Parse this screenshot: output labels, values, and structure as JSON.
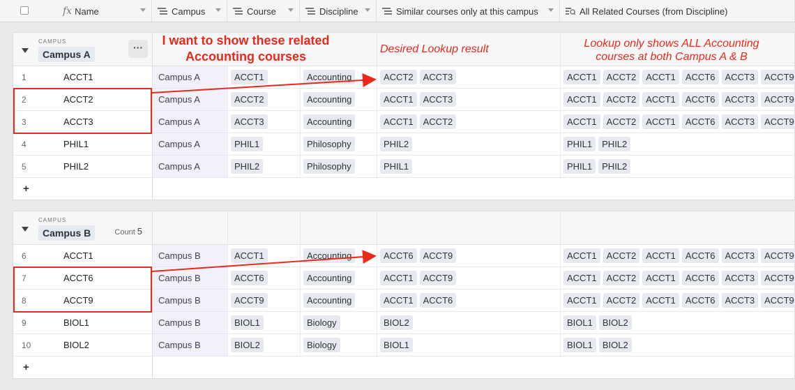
{
  "headers": {
    "name": "Name",
    "campus": "Campus",
    "course": "Course",
    "discipline": "Discipline",
    "similar": "Similar courses only at this campus",
    "related": "All Related Courses (from Discipline)"
  },
  "icons": {
    "formula": "fx",
    "text_field": "text-lines-icon",
    "lookup": "lookup-icon"
  },
  "groups": [
    {
      "label_small": "CAMPUS",
      "title": "Campus A",
      "count_label": "",
      "count_value": "",
      "rows": [
        {
          "num": "1",
          "name": "ACCT1",
          "campus": "Campus A",
          "course": "ACCT1",
          "discipline": "Accounting",
          "similar": [
            "ACCT2",
            "ACCT3"
          ],
          "related": [
            "ACCT1",
            "ACCT2",
            "ACCT1",
            "ACCT6",
            "ACCT3",
            "ACCT9"
          ]
        },
        {
          "num": "2",
          "name": "ACCT2",
          "campus": "Campus A",
          "course": "ACCT2",
          "discipline": "Accounting",
          "similar": [
            "ACCT1",
            "ACCT3"
          ],
          "related": [
            "ACCT1",
            "ACCT2",
            "ACCT1",
            "ACCT6",
            "ACCT3",
            "ACCT9"
          ]
        },
        {
          "num": "3",
          "name": "ACCT3",
          "campus": "Campus A",
          "course": "ACCT3",
          "discipline": "Accounting",
          "similar": [
            "ACCT1",
            "ACCT2"
          ],
          "related": [
            "ACCT1",
            "ACCT2",
            "ACCT1",
            "ACCT6",
            "ACCT3",
            "ACCT9"
          ]
        },
        {
          "num": "4",
          "name": "PHIL1",
          "campus": "Campus A",
          "course": "PHIL1",
          "discipline": "Philosophy",
          "similar": [
            "PHIL2"
          ],
          "related": [
            "PHIL1",
            "PHIL2"
          ]
        },
        {
          "num": "5",
          "name": "PHIL2",
          "campus": "Campus A",
          "course": "PHIL2",
          "discipline": "Philosophy",
          "similar": [
            "PHIL1"
          ],
          "related": [
            "PHIL1",
            "PHIL2"
          ]
        }
      ]
    },
    {
      "label_small": "CAMPUS",
      "title": "Campus B",
      "count_label": "Count",
      "count_value": "5",
      "rows": [
        {
          "num": "6",
          "name": "ACCT1",
          "campus": "Campus B",
          "course": "ACCT1",
          "discipline": "Accounting",
          "similar": [
            "ACCT6",
            "ACCT9"
          ],
          "related": [
            "ACCT1",
            "ACCT2",
            "ACCT1",
            "ACCT6",
            "ACCT3",
            "ACCT9"
          ]
        },
        {
          "num": "7",
          "name": "ACCT6",
          "campus": "Campus B",
          "course": "ACCT6",
          "discipline": "Accounting",
          "similar": [
            "ACCT1",
            "ACCT9"
          ],
          "related": [
            "ACCT1",
            "ACCT2",
            "ACCT1",
            "ACCT6",
            "ACCT3",
            "ACCT9"
          ]
        },
        {
          "num": "8",
          "name": "ACCT9",
          "campus": "Campus B",
          "course": "ACCT9",
          "discipline": "Accounting",
          "similar": [
            "ACCT1",
            "ACCT6"
          ],
          "related": [
            "ACCT1",
            "ACCT2",
            "ACCT1",
            "ACCT6",
            "ACCT3",
            "ACCT9"
          ]
        },
        {
          "num": "9",
          "name": "BIOL1",
          "campus": "Campus B",
          "course": "BIOL1",
          "discipline": "Biology",
          "similar": [
            "BIOL2"
          ],
          "related": [
            "BIOL1",
            "BIOL2"
          ]
        },
        {
          "num": "10",
          "name": "BIOL2",
          "campus": "Campus B",
          "course": "BIOL2",
          "discipline": "Biology",
          "similar": [
            "BIOL1"
          ],
          "related": [
            "BIOL1",
            "BIOL2"
          ]
        }
      ]
    }
  ],
  "add_row_label": "+",
  "annotations": {
    "note1_line1": "I want to show these related",
    "note1_line2": "Accounting courses",
    "note2": "Desired Lookup result",
    "note3_line1": "Lookup only shows ALL Accounting",
    "note3_line2": "courses at both Campus A & B"
  },
  "colors": {
    "annotation_red": "#e8291c",
    "chip_bg": "#e6e9f0",
    "campus_cell_bg": "#f2f0fb"
  }
}
